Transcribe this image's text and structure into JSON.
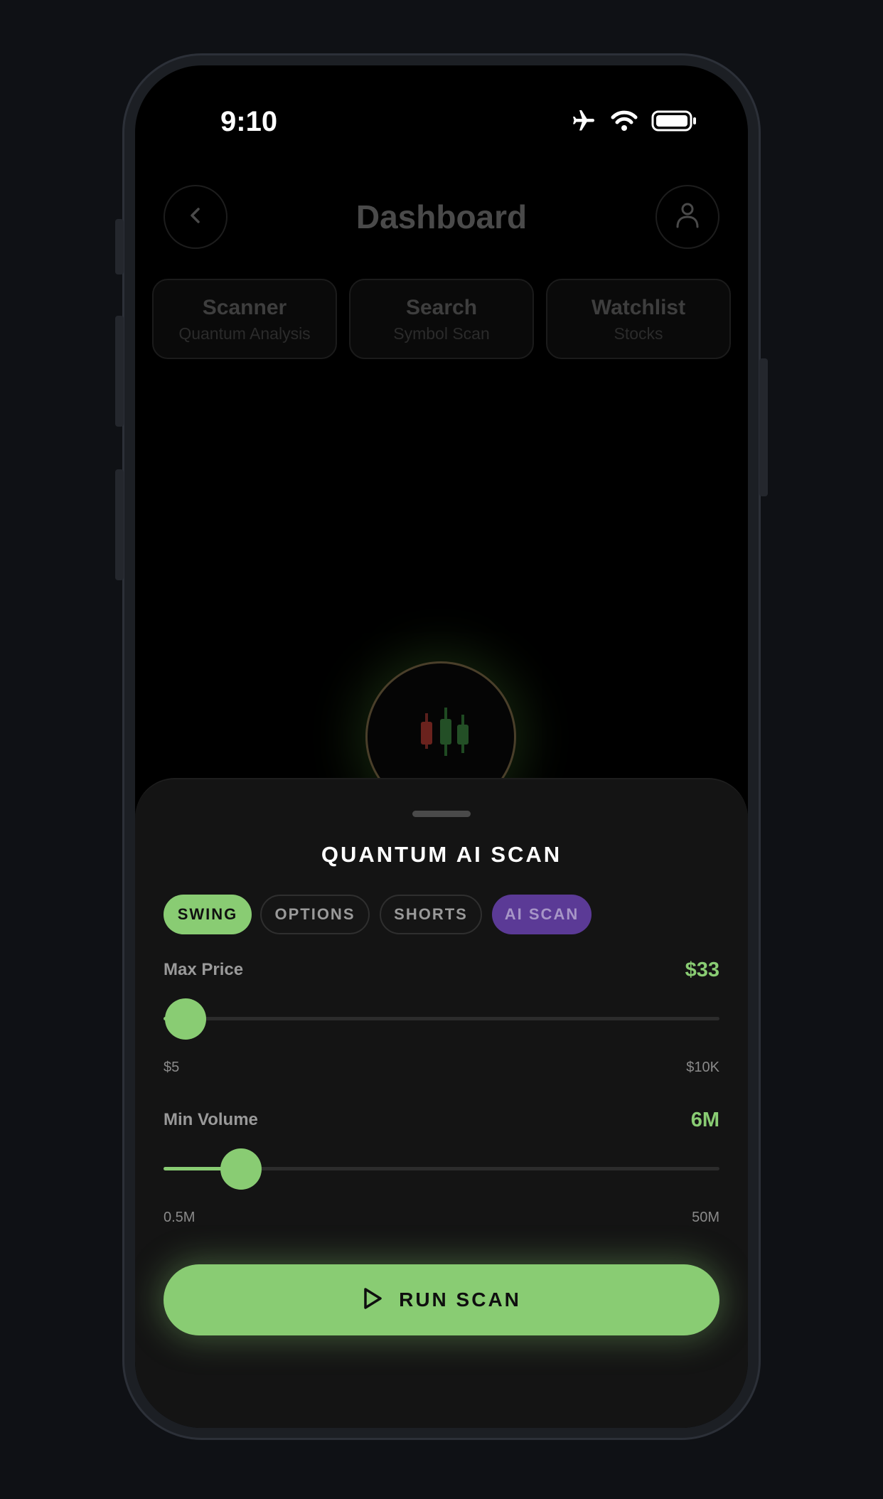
{
  "status_bar": {
    "time": "9:10",
    "icons": [
      "airplane-icon",
      "wifi-icon",
      "battery-icon"
    ]
  },
  "header": {
    "title": "Dashboard",
    "back_icon": "chevron-left-icon",
    "profile_icon": "user-icon"
  },
  "tabs": [
    {
      "title": "Scanner",
      "subtitle": "Quantum Analysis"
    },
    {
      "title": "Search",
      "subtitle": "Symbol Scan"
    },
    {
      "title": "Watchlist",
      "subtitle": "Stocks"
    }
  ],
  "center_icon": "candlestick-icon",
  "sheet": {
    "title": "QUANTUM AI SCAN",
    "chips": [
      {
        "label": "SWING",
        "state": "active"
      },
      {
        "label": "OPTIONS",
        "state": "idle"
      },
      {
        "label": "SHORTS",
        "state": "idle"
      },
      {
        "label": "AI SCAN",
        "state": "ai"
      }
    ],
    "max_price": {
      "label": "Max Price",
      "value": "$33",
      "min_label": "$5",
      "max_label": "$10K",
      "fraction": 0.04
    },
    "min_volume": {
      "label": "Min Volume",
      "value": "6M",
      "min_label": "0.5M",
      "max_label": "50M",
      "fraction": 0.14
    },
    "run_button": {
      "label": "RUN SCAN",
      "icon": "play-icon"
    }
  },
  "colors": {
    "accent": "#89cc73",
    "ai_chip": "#5b3a96",
    "background": "#000000",
    "sheet": "#141414"
  }
}
